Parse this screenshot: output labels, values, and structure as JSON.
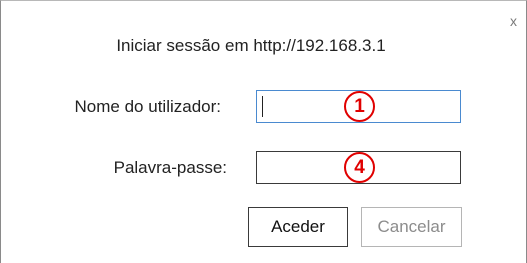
{
  "dialog": {
    "close_label": "x",
    "title": "Iniciar sessão em http://192.168.3.1",
    "username": {
      "label": "Nome do utilizador:",
      "value": "",
      "badge": "1"
    },
    "password": {
      "label": "Palavra-passe:",
      "value": "",
      "badge": "4"
    },
    "buttons": {
      "ok": "Aceder",
      "cancel": "Cancelar"
    }
  },
  "colors": {
    "focus_border": "#4a8ad0",
    "badge": "#e00000",
    "disabled_text": "#8c8c8c"
  }
}
